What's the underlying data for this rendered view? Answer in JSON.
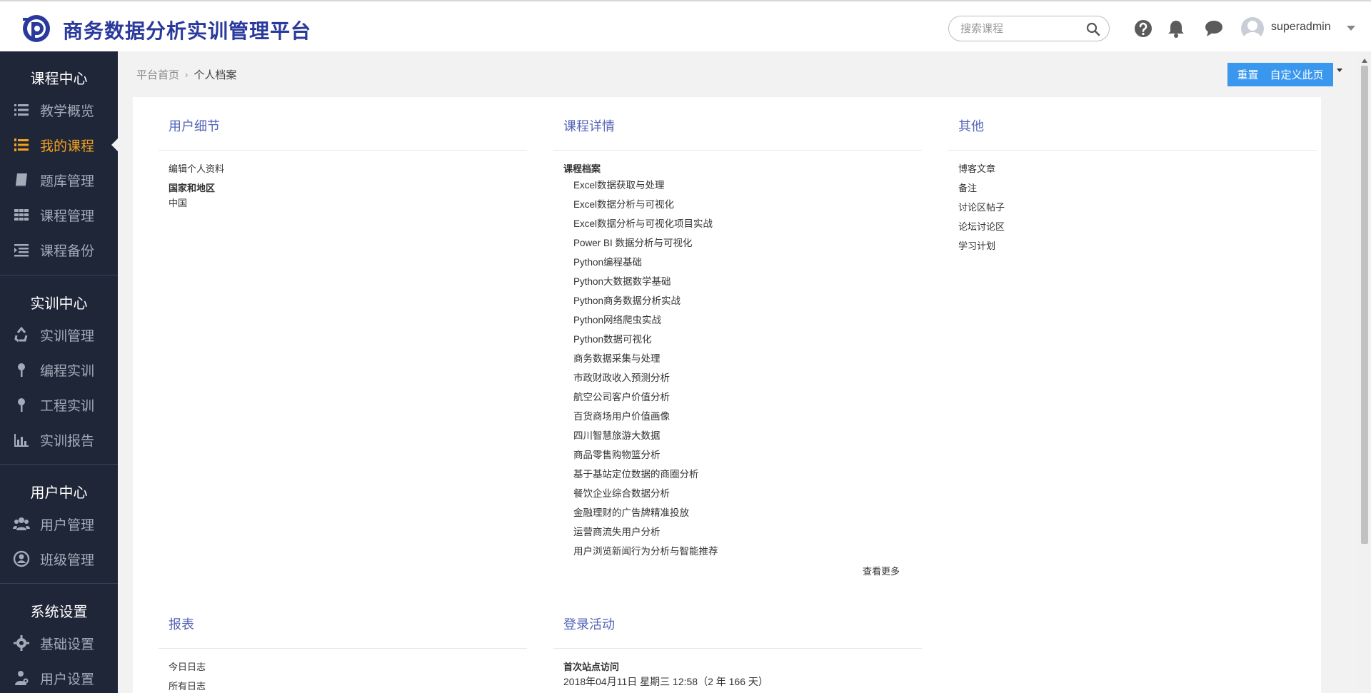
{
  "app": {
    "title": "商务数据分析实训管理平台"
  },
  "header": {
    "search_placeholder": "搜索课程",
    "username": "superadmin"
  },
  "sidebar": {
    "sections": [
      {
        "title": "课程中心",
        "items": [
          {
            "label": "教学概览",
            "icon": "list-icon"
          },
          {
            "label": "我的课程",
            "icon": "numbered-list-icon",
            "active": true
          },
          {
            "label": "题库管理",
            "icon": "book-icon"
          },
          {
            "label": "课程管理",
            "icon": "grid-icon"
          },
          {
            "label": "课程备份",
            "icon": "indent-icon"
          }
        ]
      },
      {
        "title": "实训中心",
        "items": [
          {
            "label": "实训管理",
            "icon": "recycle-icon"
          },
          {
            "label": "编程实训",
            "icon": "pin-icon"
          },
          {
            "label": "工程实训",
            "icon": "pin-icon"
          },
          {
            "label": "实训报告",
            "icon": "bar-chart-icon"
          }
        ]
      },
      {
        "title": "用户中心",
        "items": [
          {
            "label": "用户管理",
            "icon": "users-icon"
          },
          {
            "label": "班级管理",
            "icon": "user-circle-icon"
          }
        ]
      },
      {
        "title": "系统设置",
        "items": [
          {
            "label": "基础设置",
            "icon": "gear-icon"
          },
          {
            "label": "用户设置",
            "icon": "user-cog-icon"
          }
        ]
      }
    ]
  },
  "breadcrumb": {
    "home": "平台首页",
    "current": "个人档案"
  },
  "toolbar": {
    "reset": "重置",
    "customize": "自定义此页"
  },
  "columns": {
    "user_details": {
      "title": "用户细节",
      "edit_profile": "编辑个人资料",
      "country_label": "国家和地区",
      "country_value": "中国"
    },
    "course_details": {
      "title": "课程详情",
      "profile_label": "课程档案",
      "courses": [
        "Excel数据获取与处理",
        "Excel数据分析与可视化",
        "Excel数据分析与可视化项目实战",
        "Power BI 数据分析与可视化",
        "Python编程基础",
        "Python大数据数学基础",
        "Python商务数据分析实战",
        "Python网络爬虫实战",
        "Python数据可视化",
        "商务数据采集与处理",
        "市政财政收入预测分析",
        "航空公司客户价值分析",
        "百货商场用户价值画像",
        "四川智慧旅游大数据",
        "商品零售购物篮分析",
        "基于基站定位数据的商圈分析",
        "餐饮企业综合数据分析",
        "金融理财的广告牌精准投放",
        "运营商流失用户分析",
        "用户浏览新闻行为分析与智能推荐"
      ],
      "more": "查看更多"
    },
    "other": {
      "title": "其他",
      "items": [
        "博客文章",
        "备注",
        "讨论区帖子",
        "论坛讨论区",
        "学习计划"
      ]
    },
    "reports": {
      "title": "报表",
      "items": [
        "今日日志",
        "所有日志"
      ]
    },
    "login_activity": {
      "title": "登录活动",
      "first_access_label": "首次站点访问",
      "first_access_value": "2018年04月11日 星期三 12:58（2 年 166 天）"
    }
  }
}
